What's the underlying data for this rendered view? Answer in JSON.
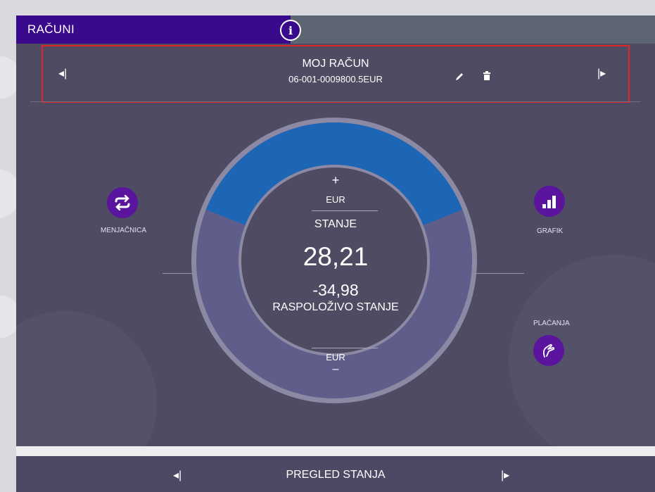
{
  "header": {
    "title": "RAČUNI",
    "info_icon_glyph": "i"
  },
  "account": {
    "name": "MOJ RAČUN",
    "number": "06-001-0009800.5EUR",
    "prev_glyph": "◂|",
    "next_glyph": "|▸"
  },
  "balance": {
    "top_sign": "+",
    "top_currency": "EUR",
    "label": "STANJE",
    "amount": "28,21",
    "available_amount": "-34,98",
    "available_label": "RASPOLOŽIVO STANJE",
    "bottom_currency": "EUR",
    "bottom_sign": "–",
    "ring_fill_fraction": 0.38
  },
  "actions": {
    "exchange_label": "MENJAČNICA",
    "chart_label": "GRAFIK",
    "payments_label": "PLAĆANJA"
  },
  "footer": {
    "title": "PREGLED STANJA",
    "prev_glyph": "◂|",
    "next_glyph": "|▸"
  },
  "colors": {
    "brand_purple": "#3a0a8c",
    "button_purple": "#5a149e",
    "panel_bg": "#4e4b62",
    "ring_blue": "#1d65b5",
    "ring_gray": "#5f5e8a",
    "highlight_red": "#e0262a"
  }
}
